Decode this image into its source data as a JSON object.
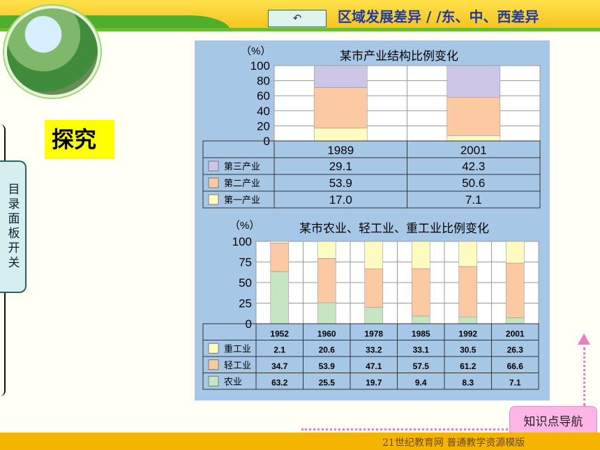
{
  "header": {
    "title": "区域发展差异 / /东、中、西差异",
    "back_icon": "↶"
  },
  "side_tab": {
    "label": "目录面板开关"
  },
  "explore_label": "探究",
  "nav_button": {
    "label": "知识点导航"
  },
  "footer": {
    "text": "21世纪教育网   普通教学资源模版"
  },
  "chart_data": [
    {
      "type": "bar",
      "title": "某市产业结构比例变化",
      "unit": "（%）",
      "categories": [
        "1989",
        "2001"
      ],
      "ylim": [
        0,
        100
      ],
      "yticks": [
        "100",
        "80",
        "60",
        "40",
        "20",
        "0"
      ],
      "series": [
        {
          "name": "第三产业",
          "values": [
            29.1,
            42.3
          ],
          "color": "#cdc6e6"
        },
        {
          "name": "第二产业",
          "values": [
            53.9,
            50.6
          ],
          "color": "#fbc9a2"
        },
        {
          "name": "第一产业",
          "values": [
            17.0,
            7.1
          ],
          "color": "#fefbc0"
        }
      ],
      "table_values": {
        "第三产业": [
          "29.1",
          "42.3"
        ],
        "第二产业": [
          "53.9",
          "50.6"
        ],
        "第一产业": [
          "17.0",
          "7.1"
        ]
      }
    },
    {
      "type": "bar",
      "title": "某市农业、轻工业、重工业比例变化",
      "unit": "（%）",
      "categories": [
        "1952",
        "1960",
        "1978",
        "1985",
        "1992",
        "2001"
      ],
      "ylim": [
        0,
        100
      ],
      "yticks": [
        "100",
        "75",
        "50",
        "25",
        "0"
      ],
      "series": [
        {
          "name": "重工业",
          "values": [
            2.1,
            20.6,
            33.2,
            33.1,
            30.5,
            26.3
          ],
          "color": "#fefbc0"
        },
        {
          "name": "轻工业",
          "values": [
            34.7,
            53.9,
            47.1,
            57.5,
            61.2,
            66.6
          ],
          "color": "#fbc9a2"
        },
        {
          "name": "农业",
          "values": [
            63.2,
            25.5,
            19.7,
            9.4,
            8.3,
            7.1
          ],
          "color": "#c6e6c2"
        }
      ],
      "table_values": {
        "重工业": [
          "2.1",
          "20.6",
          "33.2",
          "33.1",
          "30.5",
          "26.3"
        ],
        "轻工业": [
          "34.7",
          "53.9",
          "47.1",
          "57.5",
          "61.2",
          "66.6"
        ],
        "农业": [
          "63.2",
          "25.5",
          "19.7",
          "9.4",
          "8.3",
          "7.1"
        ]
      }
    }
  ]
}
